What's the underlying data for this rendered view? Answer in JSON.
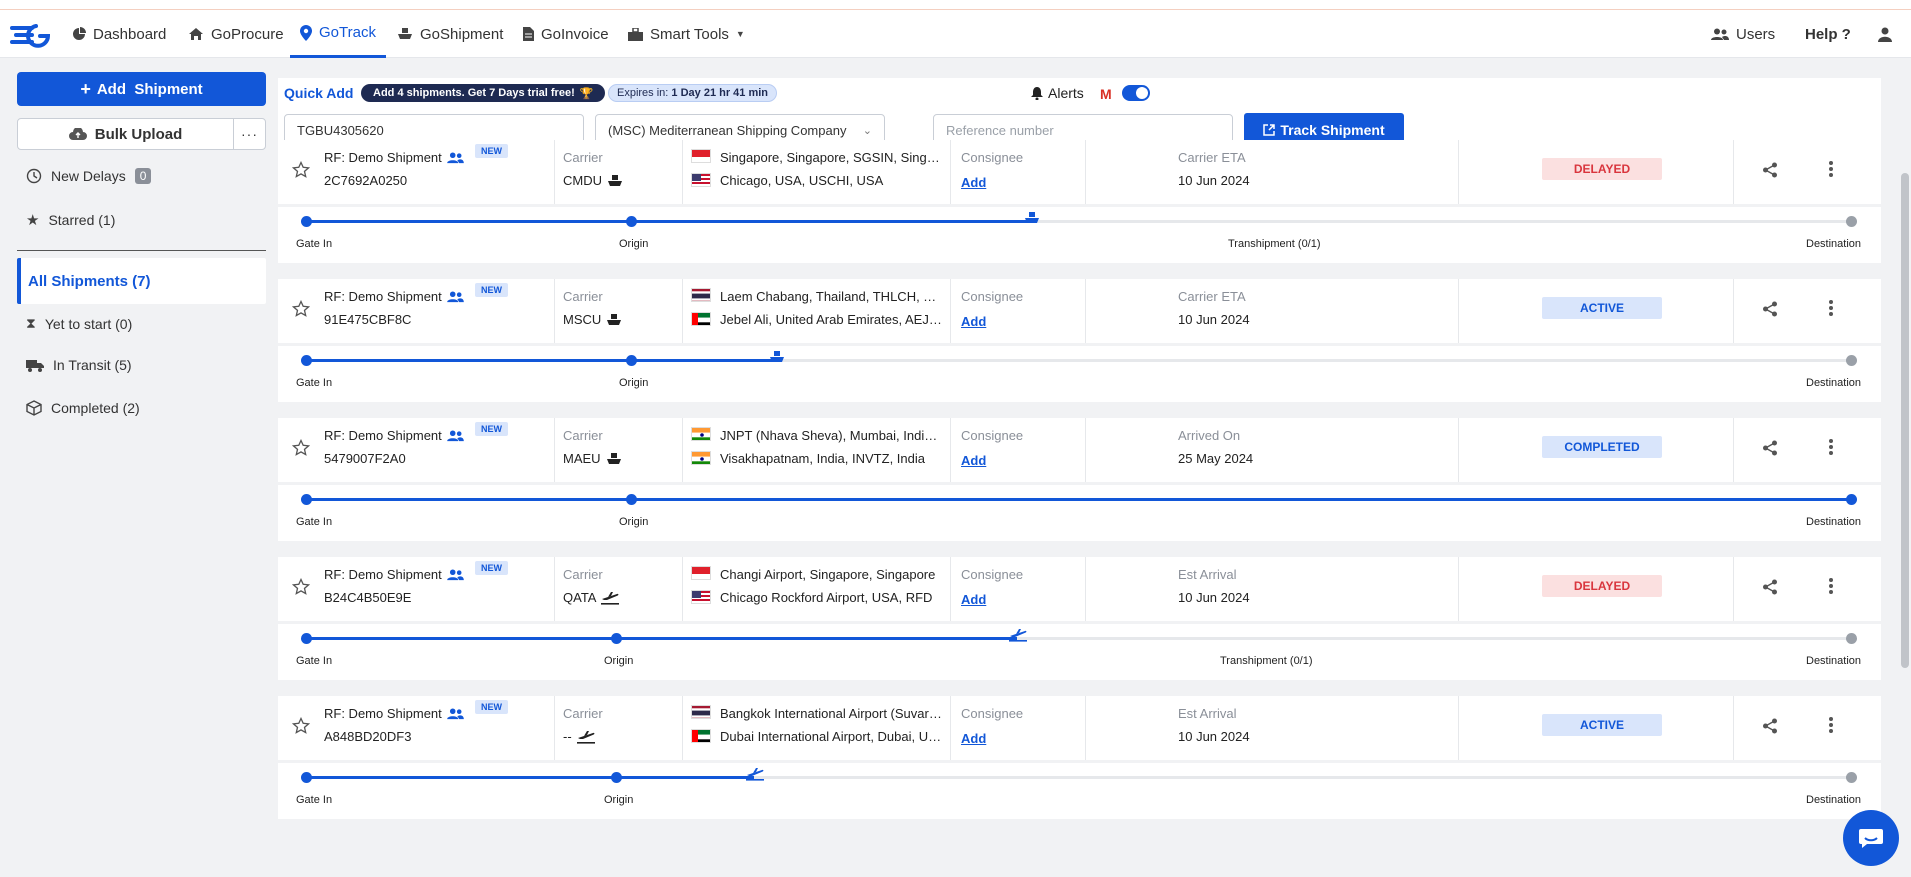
{
  "nav": {
    "items": [
      {
        "label": "Dashboard",
        "icon": "pie-chart-icon"
      },
      {
        "label": "GoProcure",
        "icon": "home-icon"
      },
      {
        "label": "GoTrack",
        "icon": "location-pin-icon",
        "active": true
      },
      {
        "label": "GoShipment",
        "icon": "ship-icon"
      },
      {
        "label": "GoInvoice",
        "icon": "document-icon"
      },
      {
        "label": "Smart Tools",
        "icon": "toolbox-icon"
      }
    ],
    "users_label": "Users",
    "help_label": "Help ?"
  },
  "sidebar": {
    "add_shipment": "Add  Shipment",
    "bulk_upload": "Bulk Upload",
    "more": "···",
    "new_delays_label": "New Delays",
    "new_delays_count": "0",
    "starred": "Starred (1)",
    "all_shipments": "All Shipments (7)",
    "yet_to_start": "Yet to start (0)",
    "in_transit": "In Transit (5)",
    "completed": "Completed (2)"
  },
  "quick_add": {
    "title": "Quick Add",
    "promo": "Add 4 shipments. Get 7 Days trial free!",
    "expires_prefix": "Expires in:",
    "expires_value": "1 Day 21 hr 41 min",
    "alerts": "Alerts",
    "container_value": "TGBU4305620",
    "carrier_value": "(MSC) Mediterranean Shipping Company",
    "reference_placeholder": "Reference number",
    "track_button": "Track Shipment"
  },
  "labels": {
    "carrier": "Carrier",
    "consignee": "Consignee",
    "add": "Add",
    "gate_in": "Gate In",
    "origin": "Origin",
    "destination": "Destination",
    "new": "NEW"
  },
  "shipments": [
    {
      "ref": "RF: Demo Shipment",
      "id": "2C7692A0250",
      "carrier": "CMDU",
      "mode": "ship",
      "from": "Singapore, Singapore, SGSIN, Singapore",
      "to": "Chicago, USA, USCHI, USA",
      "eta_label": "Carrier ETA",
      "eta": "10 Jun 2024",
      "status": "DELAYED",
      "status_type": "delayed",
      "progress": 0.47,
      "transhipment": "Transhipment (0/1)"
    },
    {
      "ref": "RF: Demo Shipment",
      "id": "91E475CBF8C",
      "carrier": "MSCU",
      "mode": "ship",
      "from": "Laem Chabang, Thailand, THLCH, Thailand",
      "to": "Jebel Ali, United Arab Emirates, AEJEA",
      "eta_label": "Carrier ETA",
      "eta": "10 Jun 2024",
      "status": "ACTIVE",
      "status_type": "active",
      "progress": 0.305,
      "transhipment": ""
    },
    {
      "ref": "RF: Demo Shipment",
      "id": "5479007F2A0",
      "carrier": "MAEU",
      "mode": "ship",
      "from": "JNPT (Nhava Sheva), Mumbai, India, INNSA",
      "to": "Visakhapatnam, India, INVTZ, India",
      "eta_label": "Arrived On",
      "eta": "25 May 2024",
      "status": "COMPLETED",
      "status_type": "completed",
      "progress": 1.0,
      "transhipment": ""
    },
    {
      "ref": "RF: Demo Shipment",
      "id": "B24C4B50E9E",
      "carrier": "QATA",
      "mode": "plane",
      "from": "Changi Airport, Singapore, Singapore",
      "to": "Chicago Rockford Airport, USA, RFD",
      "eta_label": "Est Arrival",
      "eta": "10 Jun 2024",
      "status": "DELAYED",
      "status_type": "delayed",
      "progress": 0.46,
      "transhipment": "Transhipment (0/1)"
    },
    {
      "ref": "RF: Demo Shipment",
      "id": "A848BD20DF3",
      "carrier": "--",
      "mode": "plane",
      "from": "Bangkok International Airport (Suvarnabhumi)",
      "to": "Dubai International Airport, Dubai, UAE",
      "eta_label": "Est Arrival",
      "eta": "10 Jun 2024",
      "status": "ACTIVE",
      "status_type": "active",
      "progress": 0.29,
      "transhipment": ""
    }
  ]
}
